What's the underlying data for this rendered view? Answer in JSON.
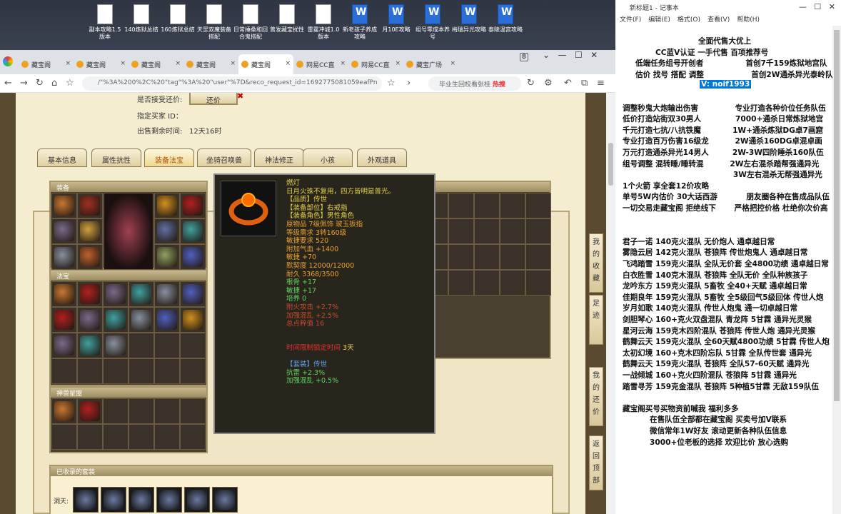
{
  "desktop": {
    "icons": [
      {
        "label": "副本攻略1.5版本",
        "type": "doc"
      },
      {
        "label": "140炼狱总结",
        "type": "doc"
      },
      {
        "label": "160炼狱总结",
        "type": "doc"
      },
      {
        "label": "天罡双魔装备搭配",
        "type": "doc"
      },
      {
        "label": "日常捶桑和回合鬼搭配",
        "type": "doc"
      },
      {
        "label": "普发藏宝扰性",
        "type": "doc"
      },
      {
        "label": "雷霆冲城1.0版本",
        "type": "doc"
      },
      {
        "label": "新老孩子养成攻略",
        "type": "word"
      },
      {
        "label": "月10E攻略",
        "type": "word"
      },
      {
        "label": "组号零成本养号",
        "type": "word"
      },
      {
        "label": "梅瑞异光攻略",
        "type": "word"
      },
      {
        "label": "泰陵温宫攻略",
        "type": "word"
      }
    ]
  },
  "browser": {
    "tabs": [
      "藏宝阁",
      "藏宝阁",
      "藏宝阁",
      "藏宝阁",
      "藏宝阁",
      "网易CC直",
      "网易CC直",
      "藏宝广场"
    ],
    "tab_count": "8",
    "url": "/\"%3A%200%2C%20\"tag\"%3A%20\"user\"%7D&reco_request_id=1692775081059eafPn",
    "search_text": "毕业生回校看张桂",
    "search_hot": "热搜"
  },
  "listing": {
    "counter_label": "是否接受还价:",
    "counter_value": "还价",
    "buyer_label": "指定买家 ID：",
    "time_label": "出售剩余时间:",
    "time_value": "12天16时"
  },
  "game_tabs": [
    "基本信息",
    "属性抗性",
    "装备法宝",
    "坐骑召唤兽",
    "神法修正",
    "小孩",
    "外观道具"
  ],
  "panels": {
    "equip": "装备",
    "fabao": "法宝",
    "lingbao": "神兽星盟",
    "inventory": "物品栏",
    "suits": "已收录的套装",
    "suit_row_label": "洞天:"
  },
  "side_buttons": [
    "我的收藏",
    "足迹",
    "我的还价",
    "返回顶部"
  ],
  "tooltip": {
    "name": "燃灯",
    "desc": "日月火珠不复用，四方皆明是普光。",
    "quality": "【品质】传世",
    "part": "【装备部位】右戒指",
    "role": "【装备角色】男性角色",
    "material": "原物品 7级佩饰 玻玉扳指",
    "level_req": "等级需求 3转160级",
    "agi_req": "敏捷要求 520",
    "qi": "附加气血 +1400",
    "agi": "敏捷 +70",
    "mana": "默契度 12000/12000",
    "dur": "耐久 3368/3500",
    "bone": "根骨 +17",
    "agi2": "敏捷 +17",
    "train": "培养 0",
    "fire": "附火攻击 +2.7%",
    "chaos": "加强混乱 +2.5%",
    "total": "总点粹值 16",
    "timer": "时间限制锁定时间",
    "timer_val": "3天",
    "set": "【套装】传世",
    "res": "抗雷 +2.3%",
    "chaos2": "加强混乱 +0.5%"
  },
  "notepad": {
    "title": "新标题1 - 记事本",
    "menu": [
      "文件(F)",
      "编辑(E)",
      "格式(O)",
      "查看(V)",
      "帮助(H)"
    ],
    "lines": [
      "全面代售大优上",
      "CC蓝V认证 一手代售 百项推荐号",
      "低端任务组号开创者                首创7千159炼狱地宫队",
      "估价 找号 搭配 调整                  首创2W通杀异光泰岭队",
      "V: noif1993",
      "",
      "调整秒鬼大炮输出伤害              专业打造各种价位任务队伍",
      "低价打造站街双30男人             7000+通杀日常炼狱地宫",
      "千元打造七抗/八抗铁魔            1W+通杀炼狱DG卓7画窟",
      "专业打造百万伤害16级龙          2W通杀160DG卓混卓画",
      "万元打造通杀异光14男人         2W-3W四阶睡杀160队伍",
      "组号调整 混转睡/睡转混          2W左右混杀踏帮强通异光",
      "                                          3W左右混杀无帮强通异光",
      "1个火箭 享全套12价攻略",
      "单号5W内估价 30大话西游           朋友圈各种在售成品队伍",
      "一切交易走藏宝阁 拒绝线下       严格把控价格 杜绝你次价高",
      "",
      "",
      "君子一诺 140克火混队 无价炮人 通卓越日常",
      "雾隐云居 142克火混队 苍狼阵 传世炮鬼人 通卓越日常",
      "飞鸿踏雪 159克火混队 全队无价套 全4800功绩 通卓越日常",
      "白衣胜雪 140克木混队 苍狼阵 全队无价 全队种族孩子",
      "龙吟东方 159克火混队 5畜牧 全40+天赋 通卓越日常",
      "佳期良年 159克火混队 5畜牧 全5级回气5级回体 传世人炮",
      "岁月如歌 140克火混队 传世人炮鬼 通一切卓越日常",
      "剑胆琴心 160+克火双盘混队 青龙阵 5甘霖 通异光灵猴",
      "星河云海 159克木四阶混队 苍狼阵 传世人炮 通异光灵猴",
      "鹤舞云天 159克火混队 全60天赋4800功绩 5甘霖 传世人炮",
      "太初幻境 160+克木四阶忘队 5甘霖 全队传世套 通异光",
      "鹤舞云天 159克火混队 苍狼阵 全队57-60天赋 通异光",
      "一战倾城 160+克火四阶混队 苍狼阵 5甘霖 通异光",
      "踏雪寻芳 159克金混队 苍狼阵 5种植5甘霖 无敌159队伍",
      "",
      "藏宝阁买号买物资前喊我 福利多多",
      "在售队伍全部都在藏宝阁 买卖号加V联系",
      "微信常年1W好友 滚动更新各种队伍信息",
      "3000+位老板的选择 欢迎比价 放心选购"
    ]
  }
}
